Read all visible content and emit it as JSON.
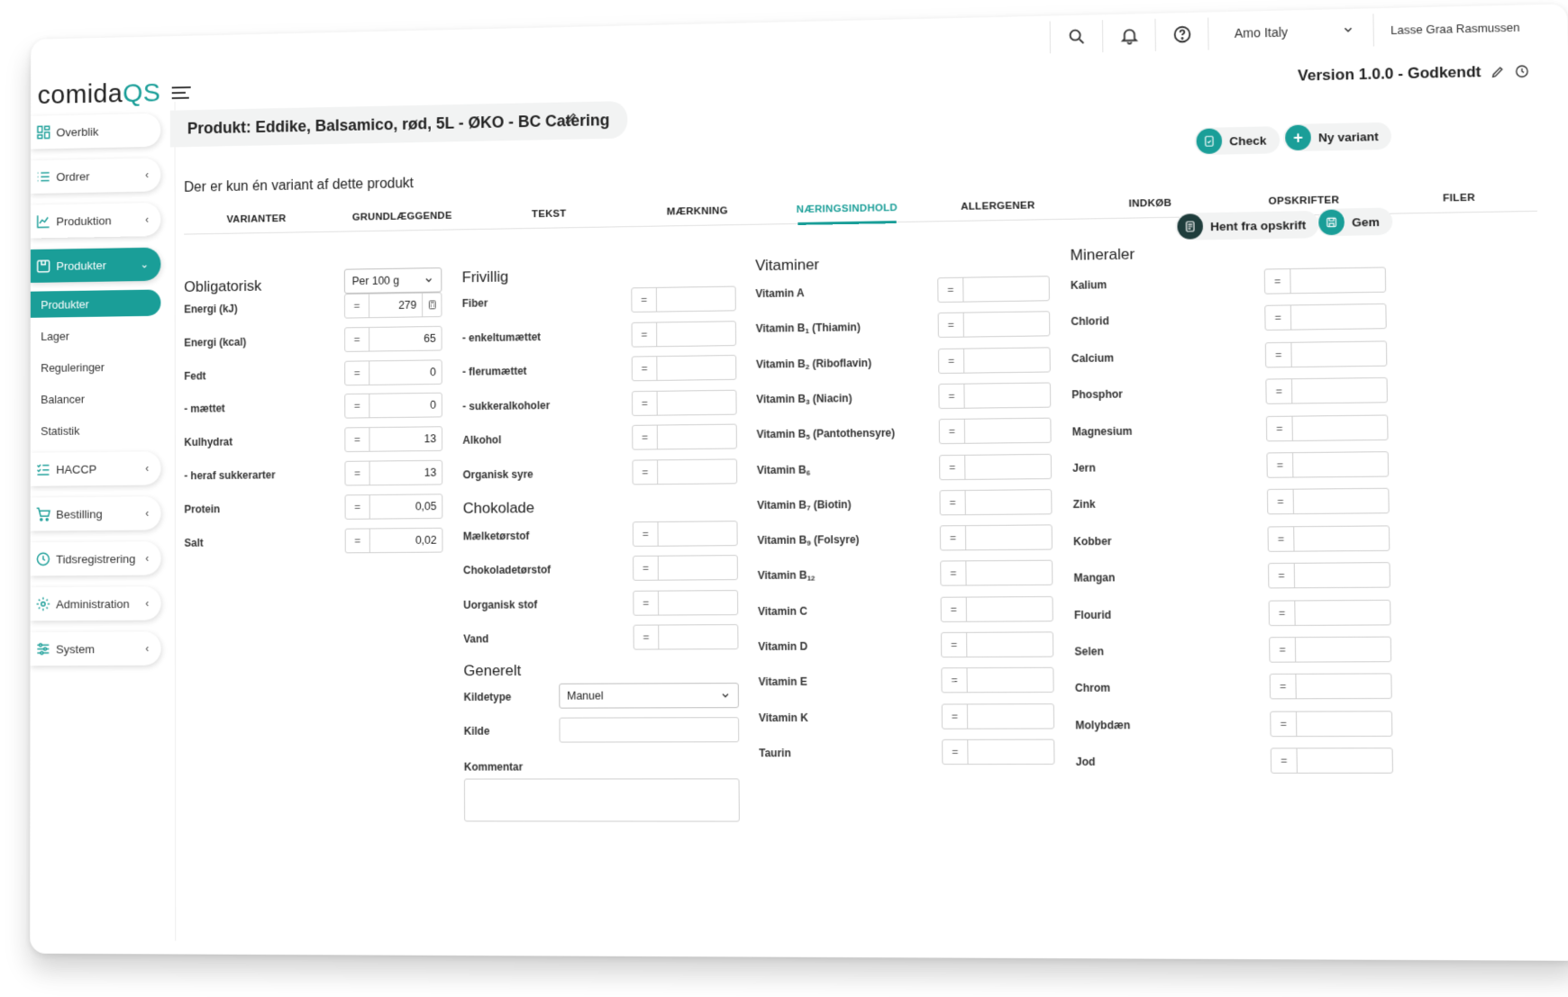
{
  "brand": {
    "logo_main": "comida",
    "logo_accent": "QS",
    "accent_color": "#1a9e98"
  },
  "topbar": {
    "company": "Amo Italy",
    "user": "Lasse Graa Rasmussen"
  },
  "sidebar": {
    "items": [
      {
        "label": "Overblik",
        "icon": "dashboard-icon",
        "chevron": ""
      },
      {
        "label": "Ordrer",
        "icon": "list-icon",
        "chevron": "‹"
      },
      {
        "label": "Produktion",
        "icon": "chart-icon",
        "chevron": "‹"
      },
      {
        "label": "Produkter",
        "icon": "box-icon",
        "chevron": "⌄"
      },
      {
        "label": "HACCP",
        "icon": "checklist-icon",
        "chevron": "‹"
      },
      {
        "label": "Bestilling",
        "icon": "cart-icon",
        "chevron": "‹"
      },
      {
        "label": "Tidsregistrering",
        "icon": "clock-icon",
        "chevron": "‹"
      },
      {
        "label": "Administration",
        "icon": "gear-icon",
        "chevron": "‹"
      },
      {
        "label": "System",
        "icon": "sliders-icon",
        "chevron": "‹"
      }
    ],
    "sub_items": [
      "Produkter",
      "Lager",
      "Reguleringer",
      "Balancer",
      "Statistik"
    ]
  },
  "header": {
    "version": "Version 1.0.0 - Godkendt",
    "product_title": "Produkt: Eddike, Balsamico, rød, 5L - ØKO - BC Catering",
    "check_label": "Check",
    "new_variant_label": "Ny variant",
    "variant_note": "Der er kun én variant af dette produkt",
    "fetch_label": "Hent fra opskrift",
    "save_label": "Gem"
  },
  "tabs": [
    "VARIANTER",
    "GRUNDLÆGGENDE",
    "TEKST",
    "MÆRKNING",
    "NÆRINGSINDHOLD",
    "ALLERGENER",
    "INDKØB",
    "OPSKRIFTER",
    "FILER"
  ],
  "active_tab": "NÆRINGSINDHOLD",
  "obligatorisk": {
    "title": "Obligatorisk",
    "unit_select": "Per 100 g",
    "rows": [
      {
        "label": "Energi (kJ)",
        "value": "279"
      },
      {
        "label": "Energi (kcal)",
        "value": "65"
      },
      {
        "label": "Fedt",
        "value": "0"
      },
      {
        "label": "- mættet",
        "value": "0"
      },
      {
        "label": "Kulhydrat",
        "value": "13"
      },
      {
        "label": "- heraf sukkerarter",
        "value": "13"
      },
      {
        "label": "Protein",
        "value": "0,05"
      },
      {
        "label": "Salt",
        "value": "0,02"
      }
    ]
  },
  "frivillig": {
    "title": "Frivillig",
    "rows": [
      "Fiber",
      "- enkeltumættet",
      "- flerumættet",
      "- sukkeralkoholer",
      "Alkohol",
      "Organisk syre"
    ]
  },
  "chokolade": {
    "title": "Chokolade",
    "rows": [
      "Mælketørstof",
      "Chokoladetørstof",
      "Uorganisk stof",
      "Vand"
    ]
  },
  "generelt": {
    "title": "Generelt",
    "source_type_label": "Kildetype",
    "source_type_value": "Manuel",
    "source_label": "Kilde",
    "comment_label": "Kommentar"
  },
  "vitaminer": {
    "title": "Vitaminer",
    "rows": [
      {
        "name": "Vitamin A",
        "sub": "",
        "suffix": ""
      },
      {
        "name": "Vitamin B",
        "sub": "1",
        "suffix": " (Thiamin)"
      },
      {
        "name": "Vitamin B",
        "sub": "2",
        "suffix": " (Riboflavin)"
      },
      {
        "name": "Vitamin B",
        "sub": "3",
        "suffix": " (Niacin)"
      },
      {
        "name": "Vitamin B",
        "sub": "5",
        "suffix": " (Pantothensyre)"
      },
      {
        "name": "Vitamin B",
        "sub": "6",
        "suffix": ""
      },
      {
        "name": "Vitamin B",
        "sub": "7",
        "suffix": " (Biotin)"
      },
      {
        "name": "Vitamin B",
        "sub": "9",
        "suffix": " (Folsyre)"
      },
      {
        "name": "Vitamin B",
        "sub": "12",
        "suffix": ""
      },
      {
        "name": "Vitamin C",
        "sub": "",
        "suffix": ""
      },
      {
        "name": "Vitamin D",
        "sub": "",
        "suffix": ""
      },
      {
        "name": "Vitamin E",
        "sub": "",
        "suffix": ""
      },
      {
        "name": "Vitamin K",
        "sub": "",
        "suffix": ""
      },
      {
        "name": "Taurin",
        "sub": "",
        "suffix": ""
      }
    ]
  },
  "mineraler": {
    "title": "Mineraler",
    "rows": [
      "Kalium",
      "Chlorid",
      "Calcium",
      "Phosphor",
      "Magnesium",
      "Jern",
      "Zink",
      "Kobber",
      "Mangan",
      "Flourid",
      "Selen",
      "Chrom",
      "Molybdæn",
      "Jod"
    ]
  },
  "eq_symbol": "="
}
